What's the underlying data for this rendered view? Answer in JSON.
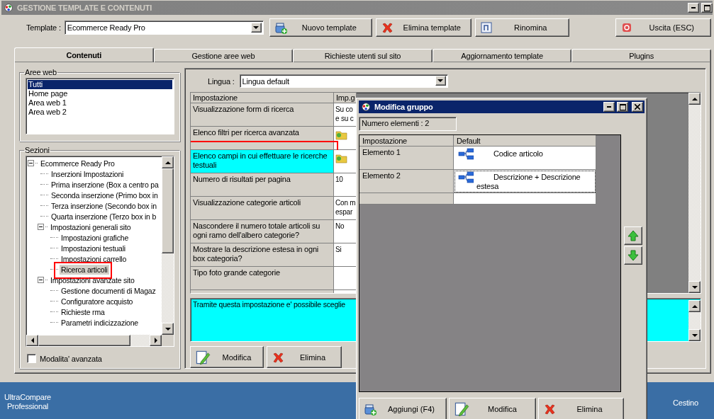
{
  "window": {
    "title": "GESTIONE TEMPLATE E CONTENUTI"
  },
  "toolbar": {
    "template_label": "Template :",
    "template_value": "Ecommerce Ready Pro",
    "buttons": [
      {
        "label": "Nuovo template",
        "kind": "add"
      },
      {
        "label": "Elimina template",
        "kind": "delete"
      },
      {
        "label": "Rinomina",
        "kind": "rename"
      },
      {
        "label": "Uscita (ESC)",
        "kind": "exit"
      }
    ]
  },
  "tabs": [
    {
      "label": "Contenuti",
      "selected": true
    },
    {
      "label": "Gestione aree web",
      "selected": false
    },
    {
      "label": "Richieste utenti sul sito",
      "selected": false
    },
    {
      "label": "Aggiornamento template",
      "selected": false
    },
    {
      "label": "Plugins",
      "selected": false
    }
  ],
  "web_areas": {
    "title": "Aree web",
    "items": [
      {
        "label": "Tutti",
        "selected": true
      },
      {
        "label": "Home page",
        "selected": false
      },
      {
        "label": "Area web 1",
        "selected": false
      },
      {
        "label": "Area web 2",
        "selected": false
      }
    ]
  },
  "sections": {
    "title": "Sezioni",
    "tree": [
      {
        "label": "Ecommerce Ready Pro",
        "expanded": true,
        "selected": false,
        "highlighted": false,
        "children": [
          {
            "label": "Inserzioni Impostazioni",
            "selected": false,
            "highlighted": false
          },
          {
            "label": "Prima inserzione (Box a centro pa",
            "selected": false,
            "highlighted": false
          },
          {
            "label": "Seconda inserzione (Primo box in",
            "selected": false,
            "highlighted": false
          },
          {
            "label": "Terza inserzione (Secondo box in",
            "selected": false,
            "highlighted": false
          },
          {
            "label": "Quarta inserzione (Terzo box in b",
            "selected": false,
            "highlighted": false
          },
          {
            "label": "Impostazioni generali sito",
            "expanded": true,
            "selected": false,
            "highlighted": false,
            "children": [
              {
                "label": "Impostazioni grafiche",
                "selected": false,
                "highlighted": false
              },
              {
                "label": "Impostazioni testuali",
                "selected": false,
                "highlighted": false
              },
              {
                "label": "Impostazioni carrello",
                "selected": false,
                "highlighted": false
              },
              {
                "label": "Ricerca articoli",
                "selected": true,
                "highlighted": true
              }
            ]
          },
          {
            "label": "Impostazioni avanzate sito",
            "expanded": true,
            "selected": false,
            "highlighted": false,
            "children": [
              {
                "label": "Gestione documenti di Magaz",
                "selected": false,
                "highlighted": false
              },
              {
                "label": "Configuratore acquisto",
                "selected": false,
                "highlighted": false
              },
              {
                "label": "Richieste rma",
                "selected": false,
                "highlighted": false
              },
              {
                "label": "Parametri indicizzazione",
                "selected": false,
                "highlighted": false
              }
            ]
          }
        ]
      }
    ]
  },
  "advanced_mode": {
    "label": "Modalita' avanzata",
    "checked": false
  },
  "language": {
    "label": "Lingua :",
    "value": "Lingua default"
  },
  "settings_table": {
    "columns": [
      "Impostazione",
      "Imp.g"
    ],
    "rows": [
      {
        "setting": "Visualizzazione form di ricerca",
        "kind": "text",
        "value": "Su co\ne su c",
        "selected": false,
        "highlighted": false
      },
      {
        "setting": "Elenco filtri per ricerca avanzata",
        "kind": "folder",
        "selected": false,
        "highlighted": false
      },
      {
        "setting": "Elenco campi in cui effettuare le ricerche testuali",
        "kind": "folder",
        "selected": true,
        "highlighted": true
      },
      {
        "setting": "Numero di risultati per pagina",
        "kind": "text",
        "value": "10",
        "selected": false,
        "highlighted": false
      },
      {
        "setting": "Visualizzazione categorie articoli",
        "kind": "text",
        "value": "Con m\nespar",
        "selected": false,
        "highlighted": false
      },
      {
        "setting": "Nascondere il numero totale articoli su ogni ramo dell'albero categorie?",
        "kind": "text",
        "value": "No",
        "selected": false,
        "highlighted": false
      },
      {
        "setting": "Mostrare la descrizione estesa in ogni box categoria?",
        "kind": "text",
        "value": "Si",
        "selected": false,
        "highlighted": false
      },
      {
        "setting": "Tipo foto grande categorie",
        "kind": "empty",
        "selected": false,
        "highlighted": false
      }
    ]
  },
  "description": "Tramite questa impostazione e' possibile sceglie",
  "actions": [
    {
      "label": "Modifica",
      "kind": "edit"
    },
    {
      "label": "Elimina",
      "kind": "delete"
    }
  ],
  "dialog": {
    "title": "Modifica gruppo",
    "count": "Numero elementi : 2",
    "columns": [
      "Impostazione",
      "Default"
    ],
    "rows": [
      {
        "name": "Elemento 1",
        "value": "Codice articolo",
        "focused": false
      },
      {
        "name": "Elemento 2",
        "value": "Descrizione + Descrizione estesa",
        "focused": true
      }
    ],
    "buttons": [
      {
        "label": "Aggiungi (F4)",
        "kind": "add"
      },
      {
        "label": "Modifica",
        "kind": "edit"
      },
      {
        "label": "Elimina",
        "kind": "delete"
      }
    ]
  },
  "desktop": {
    "icons": [
      {
        "label": "UltraCompare Professional"
      },
      {
        "label": "Cestino"
      }
    ]
  }
}
